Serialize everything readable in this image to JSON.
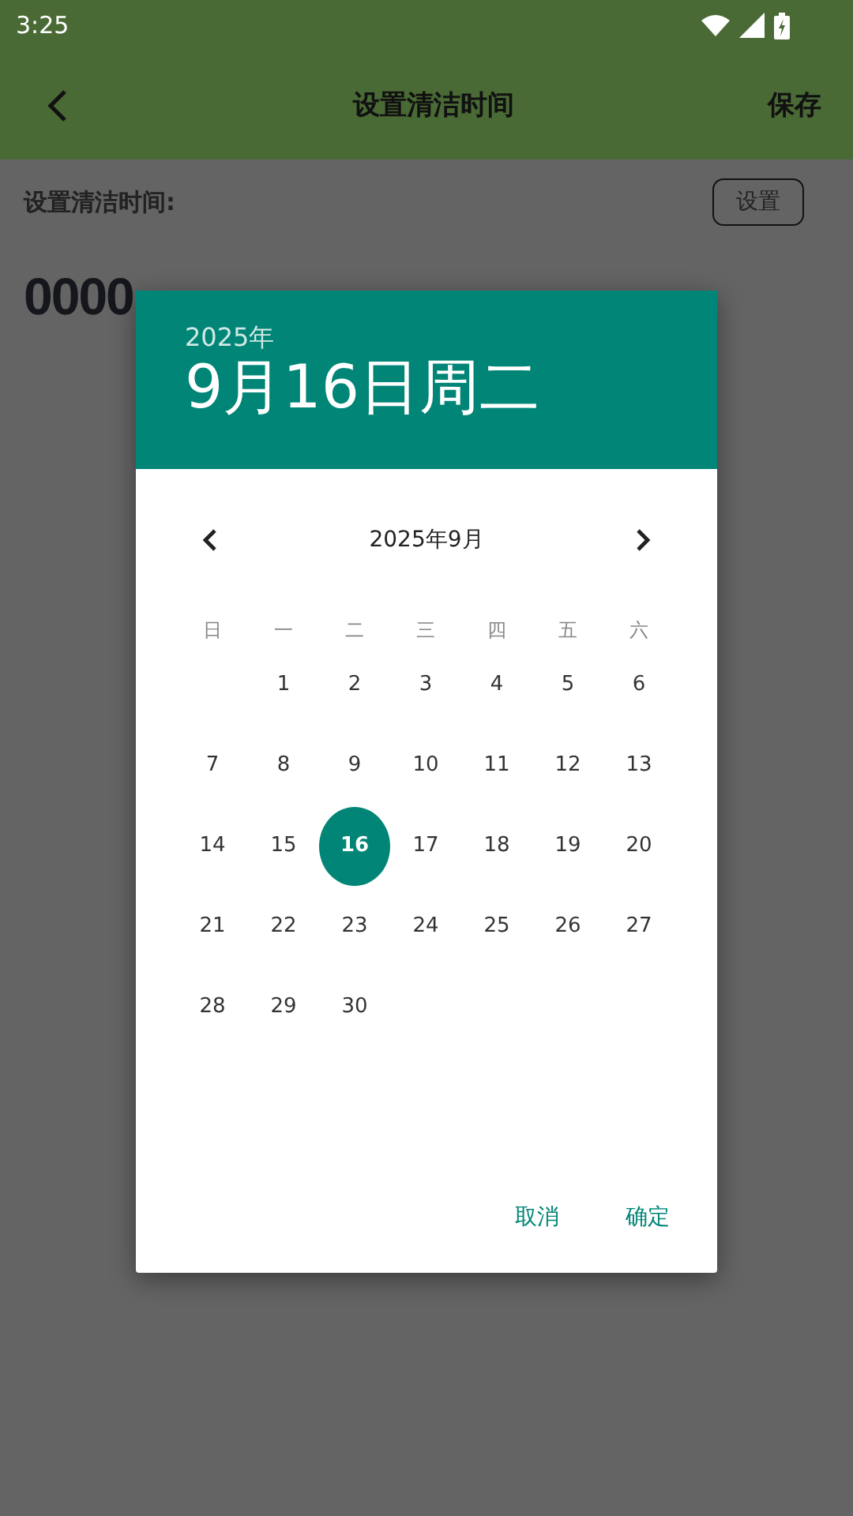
{
  "status_bar": {
    "time": "3:25"
  },
  "app_bar": {
    "title": "设置清洁时间",
    "action": "保存"
  },
  "content": {
    "label": "设置清洁时间:",
    "button": "设置",
    "value": "0000"
  },
  "dialog": {
    "year": "2025年",
    "date": "9月16日周二",
    "month": "2025年9月",
    "weekdays": [
      "日",
      "一",
      "二",
      "三",
      "四",
      "五",
      "六"
    ],
    "weeks": [
      [
        {
          "label": "1",
          "selected": false
        },
        {
          "label": "2",
          "selected": false
        },
        {
          "label": "3",
          "selected": false
        },
        {
          "label": "4",
          "selected": false
        },
        {
          "label": "5",
          "selected": false
        },
        {
          "label": "6",
          "selected": false
        }
      ],
      [
        {
          "label": "7",
          "selected": false
        },
        {
          "label": "8",
          "selected": false
        },
        {
          "label": "9",
          "selected": false
        },
        {
          "label": "10",
          "selected": false
        },
        {
          "label": "11",
          "selected": false
        },
        {
          "label": "12",
          "selected": false
        },
        {
          "label": "13",
          "selected": false
        }
      ],
      [
        {
          "label": "14",
          "selected": false
        },
        {
          "label": "15",
          "selected": false
        },
        {
          "label": "16",
          "selected": true
        },
        {
          "label": "17",
          "selected": false
        },
        {
          "label": "18",
          "selected": false
        },
        {
          "label": "19",
          "selected": false
        },
        {
          "label": "20",
          "selected": false
        }
      ],
      [
        {
          "label": "21",
          "selected": false
        },
        {
          "label": "22",
          "selected": false
        },
        {
          "label": "23",
          "selected": false
        },
        {
          "label": "24",
          "selected": false
        },
        {
          "label": "25",
          "selected": false
        },
        {
          "label": "26",
          "selected": false
        },
        {
          "label": "27",
          "selected": false
        }
      ],
      [
        {
          "label": "28",
          "selected": false
        },
        {
          "label": "29",
          "selected": false
        },
        {
          "label": "30",
          "selected": false
        }
      ]
    ],
    "buttons": [
      "取消",
      "确定"
    ]
  }
}
